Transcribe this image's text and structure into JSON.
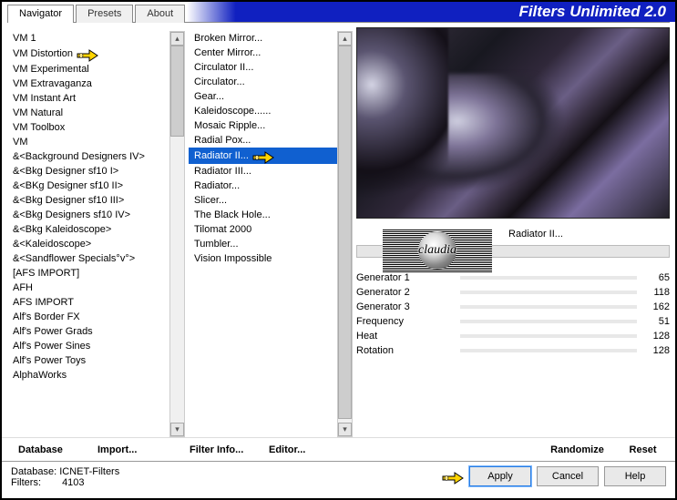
{
  "app": {
    "title": "Filters Unlimited 2.0"
  },
  "tabs": [
    {
      "label": "Navigator",
      "active": true
    },
    {
      "label": "Presets",
      "active": false
    },
    {
      "label": "About",
      "active": false
    }
  ],
  "categories": {
    "selected_index": 1,
    "items": [
      "VM 1",
      "VM Distortion",
      "VM Experimental",
      "VM Extravaganza",
      "VM Instant Art",
      "VM Natural",
      "VM Toolbox",
      "VM",
      "&<Background Designers IV>",
      "&<Bkg Designer sf10 I>",
      "&<BKg Designer sf10 II>",
      "&<Bkg Designer sf10 III>",
      "&<Bkg Designers sf10 IV>",
      "&<Bkg Kaleidoscope>",
      "&<Kaleidoscope>",
      "&<Sandflower Specials°v°>",
      "[AFS IMPORT]",
      "AFH",
      "AFS IMPORT",
      "Alf's Border FX",
      "Alf's Power Grads",
      "Alf's Power Sines",
      "Alf's Power Toys",
      "AlphaWorks"
    ]
  },
  "filters": {
    "selected_index": 8,
    "items": [
      "Broken Mirror...",
      "Center Mirror...",
      "Circulator II...",
      "Circulator...",
      "Gear...",
      "Kaleidoscope......",
      "Mosaic Ripple...",
      "Radial Pox...",
      "Radiator II...",
      "Radiator III...",
      "Radiator...",
      "Slicer...",
      "The Black Hole...",
      "Tilomat 2000",
      "Tumbler...",
      "Vision Impossible"
    ]
  },
  "current_filter_label": "Radiator II...",
  "params": [
    {
      "name": "Generator 1",
      "value": 65
    },
    {
      "name": "Generator 2",
      "value": 118
    },
    {
      "name": "Generator 3",
      "value": 162
    },
    {
      "name": "Frequency",
      "value": 51
    },
    {
      "name": "Heat",
      "value": 128
    },
    {
      "name": "Rotation",
      "value": 128
    }
  ],
  "toolbar": {
    "database": "Database",
    "import": "Import...",
    "filter_info": "Filter Info...",
    "editor": "Editor...",
    "randomize": "Randomize",
    "reset": "Reset"
  },
  "status": {
    "db_label": "Database:",
    "db_value": "ICNET-Filters",
    "filters_label": "Filters:",
    "filters_value": "4103"
  },
  "buttons": {
    "apply": "Apply",
    "cancel": "Cancel",
    "help": "Help"
  },
  "watermark": "claudia"
}
